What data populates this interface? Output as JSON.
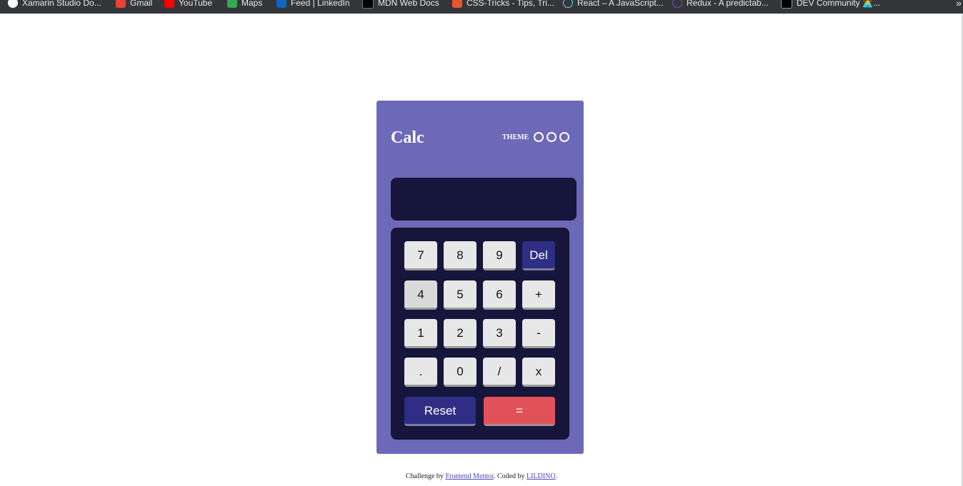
{
  "bookmarks": [
    {
      "label": "Xamarin Studio Do...",
      "icon": "xamarin-icon",
      "color": "#ffffff"
    },
    {
      "label": "Gmail",
      "icon": "gmail-icon",
      "color": "#ea4335"
    },
    {
      "label": "YouTube",
      "icon": "youtube-icon",
      "color": "#ff0000"
    },
    {
      "label": "Maps",
      "icon": "maps-icon",
      "color": "#34a853"
    },
    {
      "label": "Feed | LinkedIn",
      "icon": "linkedin-icon",
      "color": "#0a66c2"
    },
    {
      "label": "MDN Web Docs",
      "icon": "mdn-icon",
      "color": "#000000"
    },
    {
      "label": "CSS-Tricks - Tips, Tri...",
      "icon": "css-tricks-icon",
      "color": "#e8542d"
    },
    {
      "label": "React – A JavaScript...",
      "icon": "react-icon",
      "color": "#61dafb"
    },
    {
      "label": "Redux - A predictab...",
      "icon": "redux-icon",
      "color": "#764abc"
    },
    {
      "label": "DEV Community 👩‍💻...",
      "icon": "dev-icon",
      "color": "#000000"
    }
  ],
  "bookmarks_overflow": "»",
  "calculator": {
    "title": "Calc",
    "theme_label": "THEME",
    "display_value": "",
    "colors": {
      "background": "#6c69b8",
      "screen": "#16153b",
      "key": "#e8e7e8",
      "key_dark": "#302e84",
      "key_red": "#e05257"
    },
    "keys": [
      "7",
      "8",
      "9",
      "Del",
      "4",
      "5",
      "6",
      "+",
      "1",
      "2",
      "3",
      "-",
      ".",
      "0",
      "/",
      "x",
      "Reset",
      "="
    ]
  },
  "footer": {
    "text_before": "Challenge by ",
    "link1": "Frontend Mentor",
    "text_middle": ". Coded by ",
    "link2": "LILDINO",
    "text_after": "."
  }
}
